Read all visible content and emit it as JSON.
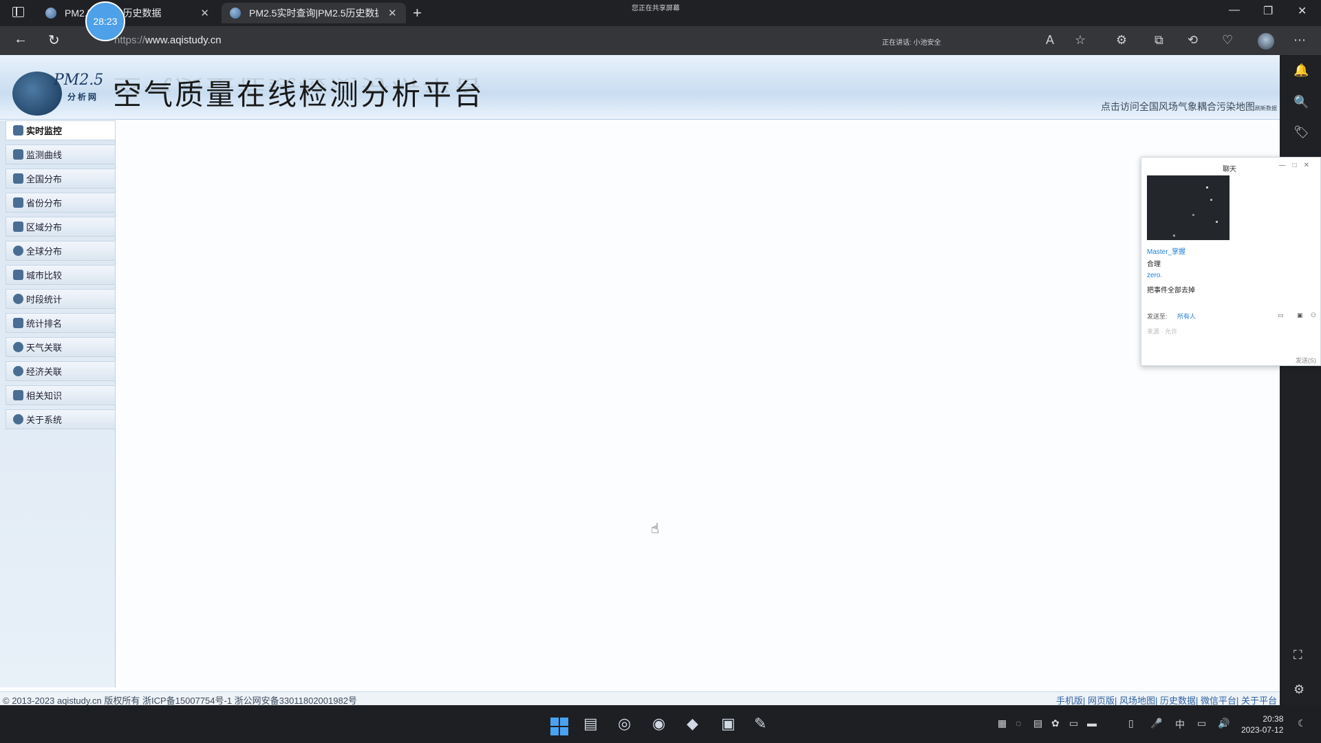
{
  "browser": {
    "tabs": [
      {
        "label": "PM2.5|PM2.5历史数据",
        "active": false
      },
      {
        "label": "PM2.5实时查询|PM2.5历史数据",
        "active": true
      }
    ],
    "timer": "28:23",
    "sharing_notice": "您正在共享屏幕",
    "url": {
      "scheme": "https://",
      "host": "www.aqistudy.cn"
    },
    "recording_notice": "正在讲话: 小池安全"
  },
  "site": {
    "logo_text": "PM2.5",
    "logo_sub": "分析网",
    "title": "空气质量在线检测分析平台",
    "banner_link": "点击访问全国风场气象耦合污染地图",
    "banner_link_small": "刷新数据",
    "menu": [
      {
        "label": "实时监控",
        "active": true
      },
      {
        "label": "监测曲线"
      },
      {
        "label": "全国分布"
      },
      {
        "label": "省份分布"
      },
      {
        "label": "区域分布"
      },
      {
        "label": "全球分布"
      },
      {
        "label": "城市比较"
      },
      {
        "label": "时段统计"
      },
      {
        "label": "统计排名"
      },
      {
        "label": "天气关联"
      },
      {
        "label": "经济关联"
      },
      {
        "label": "相关知识"
      },
      {
        "label": "关于系统"
      }
    ],
    "footer_left": "© 2013-2023 aqistudy.cn 版权所有 浙ICP备15007754号-1 浙公网安备33011802001982号",
    "footer_right": "手机版| 网页版| 风场地图| 历史数据| 微信平台| 关于平台"
  },
  "chat": {
    "title": "聊天",
    "messages": [
      {
        "sender": "Master_掌握",
        "text": "合理"
      },
      {
        "sender": "zero.",
        "text": "把事件全部去掉"
      }
    ],
    "send_to_label": "发送至:",
    "recipient": "所有人",
    "input_placeholder": "来源 · 允许",
    "send_button": "发送(S)"
  },
  "taskbar": {
    "ime": "中",
    "time": "20:38",
    "date": "2023-07-12"
  },
  "colors": {
    "accent": "#4ea0e8",
    "page_bg": "#fbfdff",
    "menu_bg": "#dbe7f3"
  }
}
